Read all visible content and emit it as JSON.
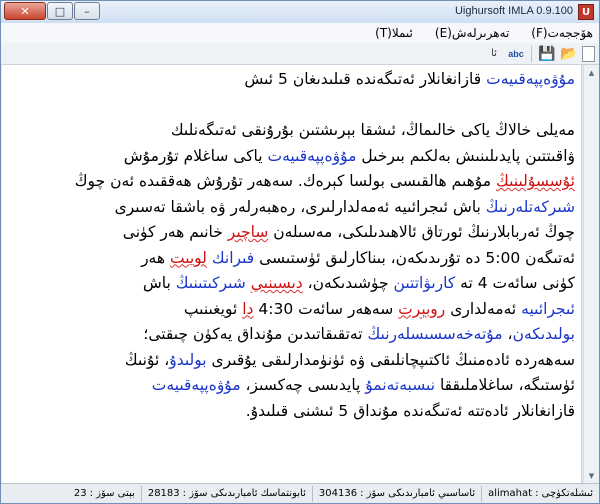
{
  "window": {
    "title": "Uighursoft IMLA 0.9.100",
    "app_icon_text": "U",
    "buttons": {
      "close": "✕",
      "maximize": "□",
      "minimize": "–"
    }
  },
  "menu": {
    "items": [
      {
        "label": "ھۆججەت(F)"
      },
      {
        "label": "تەھرىرلەش(E)"
      },
      {
        "label": "ئىملا(T)"
      }
    ]
  },
  "toolbar": {
    "new": "",
    "open": "📂",
    "save": "💾",
    "spell": "abc",
    "lang": "ئا"
  },
  "document": {
    "lines": [
      [
        {
          "t": "مۇۋەپپەقىيەت",
          "s": "kw"
        },
        {
          "t": " قازانغانلار ئەتىگەندە قىلىدىغان 5 ئىش",
          "s": ""
        }
      ],
      [],
      [
        {
          "t": "مەيلى خالاڭ ياكى خالىماڭ، ئىشقا بېرىشتىن بۇرۇنقى ئەتىگەنلىك",
          "s": ""
        }
      ],
      [
        {
          "t": "ۋاقىتتىن پايدىلىنىش بەلكىم بىرخىل ",
          "s": ""
        },
        {
          "t": "مۇۋەپپەقىيەت",
          "s": "kw"
        },
        {
          "t": " ياكى ساغلام تۇرمۇش",
          "s": ""
        }
      ],
      [
        {
          "t": "ئۇسسۇلىنىڭ",
          "s": "err"
        },
        {
          "t": " مۇھىم ھالقىسى بولسا كېرەك. سەھەر تۇرۇش ھەققىدە ئەن چوڭ",
          "s": ""
        }
      ],
      [
        {
          "t": "شىركەتلەرنىڭ",
          "s": "kw"
        },
        {
          "t": " باش ئىجرائىيە ئەمەلدارلىرى، رەھبەرلەر ۋە باشقا تەسىرى",
          "s": ""
        }
      ],
      [
        {
          "t": "چوڭ ئەربابلارنىڭ ئورتاق ئالاھىدىلىكى، مەسىلەن ",
          "s": ""
        },
        {
          "t": "ساچىر",
          "s": "err"
        },
        {
          "t": " خانىم ھەر كۈنى",
          "s": ""
        }
      ],
      [
        {
          "t": "ئەتىگەن 5:00 دە تۇرىدىكەن، بىناكارلىق ئۈستىسى ",
          "s": ""
        },
        {
          "t": "فىرانك",
          "s": "kw"
        },
        {
          "t": " ",
          "s": ""
        },
        {
          "t": "لويىت",
          "s": "err"
        },
        {
          "t": " ھەر",
          "s": ""
        }
      ],
      [
        {
          "t": "كۈنى سائەت 4 تە ",
          "s": ""
        },
        {
          "t": "كارىۋاتتىن",
          "s": "kw"
        },
        {
          "t": " چۈشىدىكەن، ",
          "s": ""
        },
        {
          "t": "دىسىنىي",
          "s": "err"
        },
        {
          "t": " ",
          "s": ""
        },
        {
          "t": "شىركىتىنىڭ",
          "s": "kw"
        },
        {
          "t": " باش",
          "s": ""
        }
      ],
      [
        {
          "t": "ئىجرائىيە",
          "s": "kw"
        },
        {
          "t": " ئەمەلدارى ",
          "s": ""
        },
        {
          "t": "روبېرت",
          "s": "err"
        },
        {
          "t": " سەھەر سائەت 4:30 ",
          "s": ""
        },
        {
          "t": "دا",
          "s": "err"
        },
        {
          "t": " ئويغىنىپ",
          "s": ""
        }
      ],
      [
        {
          "t": "بولىدىكەن",
          "s": "kw"
        },
        {
          "t": "، ",
          "s": ""
        },
        {
          "t": "مۇتەخەسسىسلەرنىڭ",
          "s": "kw"
        },
        {
          "t": " تەتقىقاتىدىن مۇنداق يەكۈن چىقتى؛",
          "s": ""
        }
      ],
      [
        {
          "t": "سەھەردە ئادەمنىڭ ئاكتىپچانلىقى ۋە ئۈنۈمدارلىقى يۇقىرى ",
          "s": ""
        },
        {
          "t": "بولىدۇ",
          "s": "kw"
        },
        {
          "t": "، ئۇنىڭ",
          "s": ""
        }
      ],
      [
        {
          "t": "ئۈستىگە، ساغلاملىققا ",
          "s": ""
        },
        {
          "t": "نىسبەتەنمۇ",
          "s": "kw"
        },
        {
          "t": " پايدىسى چەكسىز، ",
          "s": ""
        },
        {
          "t": "مۇۋەپپەقىيەت",
          "s": "kw"
        }
      ],
      [
        {
          "t": "قازانغانلار ئادەتتە ئەتىگەندە مۇنداق 5 ئىشنى قىلىدۇ.",
          "s": ""
        }
      ]
    ]
  },
  "status": {
    "user_label": "ئىشلەتكۈچى :",
    "user": "alimahat",
    "total_words_label": "ئاساسىي ئامبارىدىكى سۆز :",
    "total_words": "304136",
    "custom_words_label": "ئابونتماسك ئامبارىدىكى سۆز :",
    "custom_words": "28183",
    "page_words_label": "بېتى سۆز :",
    "page_words": "23"
  }
}
